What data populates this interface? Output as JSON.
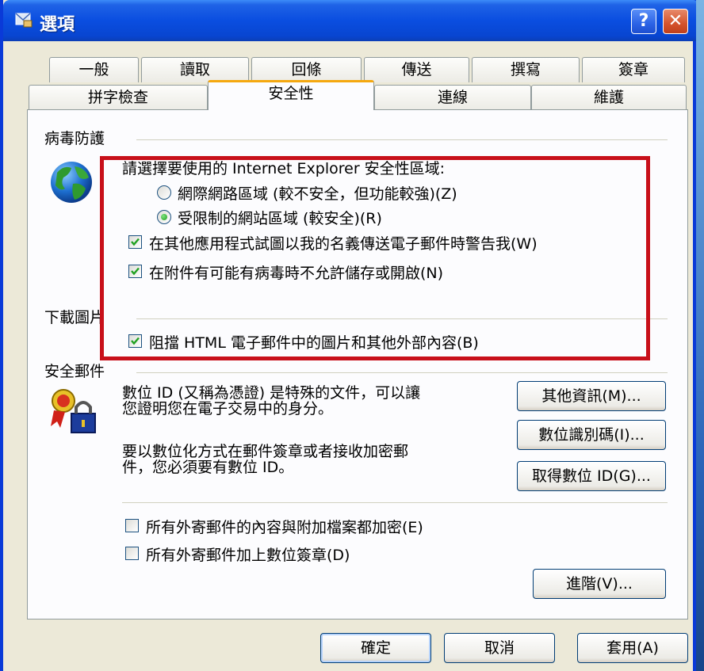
{
  "window": {
    "title": "選項",
    "help_label": "?",
    "close_label": "✕"
  },
  "tabs_row1": [
    "一般",
    "讀取",
    "回條",
    "傳送",
    "撰寫",
    "簽章"
  ],
  "tabs_row2": [
    "拼字檢查",
    "安全性",
    "連線",
    "維護"
  ],
  "active_tab": "安全性",
  "virus": {
    "group_label": "病毒防護",
    "zone_prompt": "請選擇要使用的 Internet Explorer 安全性區域:",
    "radio_internet": "網際網路區域 (較不安全，但功能較強)(Z)",
    "radio_restricted": "受限制的網站區域 (較安全)(R)",
    "selected_zone": "restricted",
    "chk_warn_label": "在其他應用程式試圖以我的名義傳送電子郵件時警告我(W)",
    "chk_warn_checked": true,
    "chk_block_attach_label": "在附件有可能有病毒時不允許儲存或開啟(N)",
    "chk_block_attach_checked": true
  },
  "download_images": {
    "group_label": "下載圖片",
    "chk_block_html_label": "阻擋 HTML 電子郵件中的圖片和其他外部內容(B)",
    "chk_block_html_checked": true
  },
  "secure_mail": {
    "group_label": "安全郵件",
    "desc1_line1": "數位 ID (又稱為憑證) 是特殊的文件，可以讓",
    "desc1_line2": "您證明您在電子交易中的身分。",
    "desc2_line1": "要以數位化方式在郵件簽章或者接收加密郵",
    "desc2_line2": "件，您必須要有數位 ID。",
    "more_info_button": "其他資訊(M)...",
    "digital_ids_button": "數位識別碼(I)...",
    "get_id_button": "取得數位 ID(G)...",
    "chk_encrypt_label": "所有外寄郵件的內容與附加檔案都加密(E)",
    "chk_encrypt_checked": false,
    "chk_sign_label": "所有外寄郵件加上數位簽章(D)",
    "chk_sign_checked": false,
    "advanced_button": "進階(V)..."
  },
  "footer": {
    "ok_button": "確定",
    "cancel_button": "取消",
    "apply_button": "套用(A)"
  },
  "colors": {
    "highlight_box": "#c8101a",
    "titlebar": "#0a4ee0",
    "active_tab_accent": "#f5a80f"
  }
}
